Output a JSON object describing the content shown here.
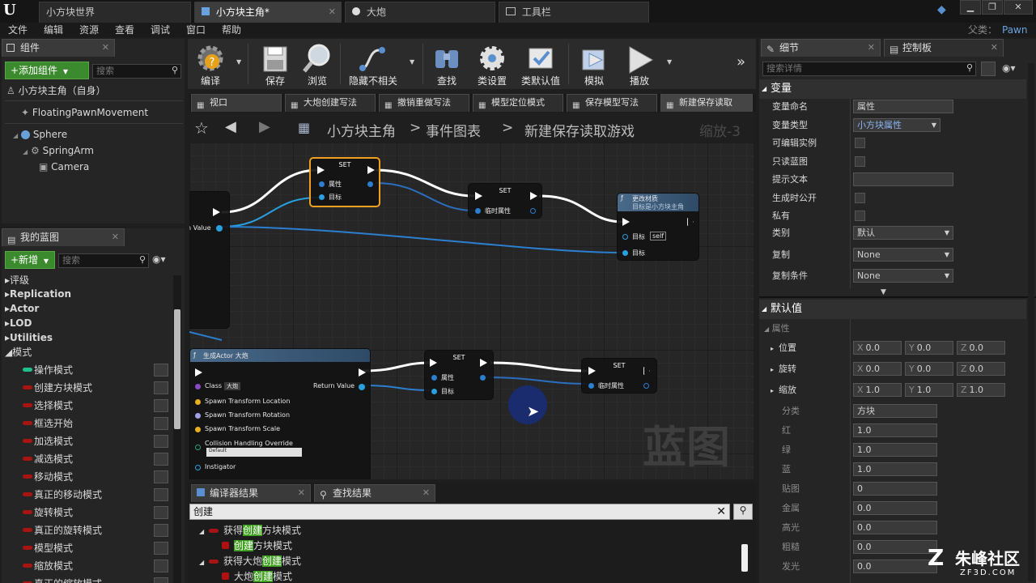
{
  "titlebar": {
    "doc_tabs": [
      {
        "label": "小方块世界"
      },
      {
        "label": "小方块主角*"
      },
      {
        "label": "大炮"
      },
      {
        "label": "工具栏"
      }
    ],
    "parent_label": "父类：",
    "parent_value": "Pawn"
  },
  "menu": [
    "文件",
    "编辑",
    "资源",
    "查看",
    "调试",
    "窗口",
    "帮助"
  ],
  "components": {
    "tab": "组件",
    "add_button": "+添加组件",
    "search_placeholder": "搜索",
    "self_row": "小方块主角（自身）",
    "items": [
      "FloatingPawnMovement",
      "Sphere",
      "SpringArm",
      "Camera"
    ]
  },
  "my_blueprint": {
    "tab": "我的蓝图",
    "new_button": "+新增",
    "search_placeholder": "搜索",
    "categories": [
      "评级",
      "Replication",
      "Actor",
      "LOD",
      "Utilities",
      "模式"
    ],
    "modes": [
      "操作模式",
      "创建方块模式",
      "选择模式",
      "框选开始",
      "加选模式",
      "减选模式",
      "移动模式",
      "真正的移动模式",
      "旋转模式",
      "真正的旋转模式",
      "模型模式",
      "缩放模式",
      "真正的缩放模式"
    ]
  },
  "toolbar": {
    "buttons": [
      "编译",
      "保存",
      "浏览",
      "隐藏不相关",
      "查找",
      "类设置",
      "类默认值",
      "模拟",
      "播放"
    ]
  },
  "graph_tabs": [
    "视口",
    "大炮创建写法",
    "撤销重做写法",
    "模型定位模式",
    "保存模型写法",
    "新建保存读取"
  ],
  "breadcrumb": {
    "root": "小方块主角",
    "sep1": ">",
    "middle": "事件图表",
    "sep2": ">",
    "leaf": "新建保存读取游戏",
    "zoom": "缩放-3"
  },
  "graph": {
    "watermark": "蓝图",
    "nodes": {
      "set1": {
        "title": "SET",
        "pin_a": "属性",
        "pin_b": "目标"
      },
      "set2": {
        "title": "SET",
        "pin_a": "临时属性"
      },
      "material": {
        "title": "更改材质",
        "subtitle": "目标是小方块主角",
        "pin_a": "目标",
        "self_tag": "self",
        "pin_b": "目标"
      },
      "left_partial": {
        "pin": "n Value"
      },
      "spawn": {
        "title": "生成Actor 大炮",
        "class_label": "Class",
        "class_value": "大炮",
        "return_value": "Return Value",
        "pins": [
          "Spawn Transform Location",
          "Spawn Transform Rotation",
          "Spawn Transform Scale",
          "Collision Handling Override"
        ],
        "collision_value": "Default",
        "instigator": "Instigator"
      },
      "set3": {
        "title": "SET",
        "pin_a": "属性",
        "pin_b": "目标"
      },
      "set4": {
        "title": "SET",
        "pin_a": "临时属性"
      }
    }
  },
  "bottom": {
    "tabs": [
      "编译器结果",
      "查找结果"
    ],
    "search_value": "创建",
    "results": [
      {
        "pre": "获得",
        "hit": "创建",
        "post": "方块模式"
      },
      {
        "pre": "",
        "hit": "创建",
        "post": "方块模式"
      },
      {
        "pre": "获得大炮",
        "hit": "创建",
        "post": "模式"
      },
      {
        "pre": "大炮",
        "hit": "创建",
        "post": "模式"
      }
    ]
  },
  "details": {
    "tabs": [
      "细节",
      "控制板"
    ],
    "search_placeholder": "搜索详情",
    "variable_section": "变量",
    "rows": [
      {
        "label": "变量命名",
        "value": "属性"
      },
      {
        "label": "变量类型",
        "value": "小方块属性"
      },
      {
        "label": "可编辑实例",
        "value": ""
      },
      {
        "label": "只读蓝图",
        "value": ""
      },
      {
        "label": "提示文本",
        "value": ""
      },
      {
        "label": "生成时公开",
        "value": ""
      },
      {
        "label": "私有",
        "value": ""
      },
      {
        "label": "类别",
        "value": "默认"
      },
      {
        "label": "复制",
        "value": "None"
      },
      {
        "label": "复制条件",
        "value": "None"
      }
    ],
    "default_section": "默认值",
    "default_group": "属性",
    "transform": [
      {
        "label": "位置",
        "x": "0.0",
        "y": "0.0",
        "z": "0.0"
      },
      {
        "label": "旋转",
        "x": "0.0",
        "y": "0.0",
        "z": "0.0"
      },
      {
        "label": "缩放",
        "x": "1.0",
        "y": "1.0",
        "z": "1.0"
      }
    ],
    "props": [
      {
        "label": "分类",
        "value": "方块"
      },
      {
        "label": "红",
        "value": "1.0"
      },
      {
        "label": "绿",
        "value": "1.0"
      },
      {
        "label": "蓝",
        "value": "1.0"
      },
      {
        "label": "贴图",
        "value": "0"
      },
      {
        "label": "金属",
        "value": "0.0"
      },
      {
        "label": "高光",
        "value": "0.0"
      },
      {
        "label": "粗糙",
        "value": "0.0"
      },
      {
        "label": "发光",
        "value": "0.0"
      }
    ]
  },
  "watermark": {
    "brand": "朱峰社区",
    "site": "ZF3D.COM"
  }
}
